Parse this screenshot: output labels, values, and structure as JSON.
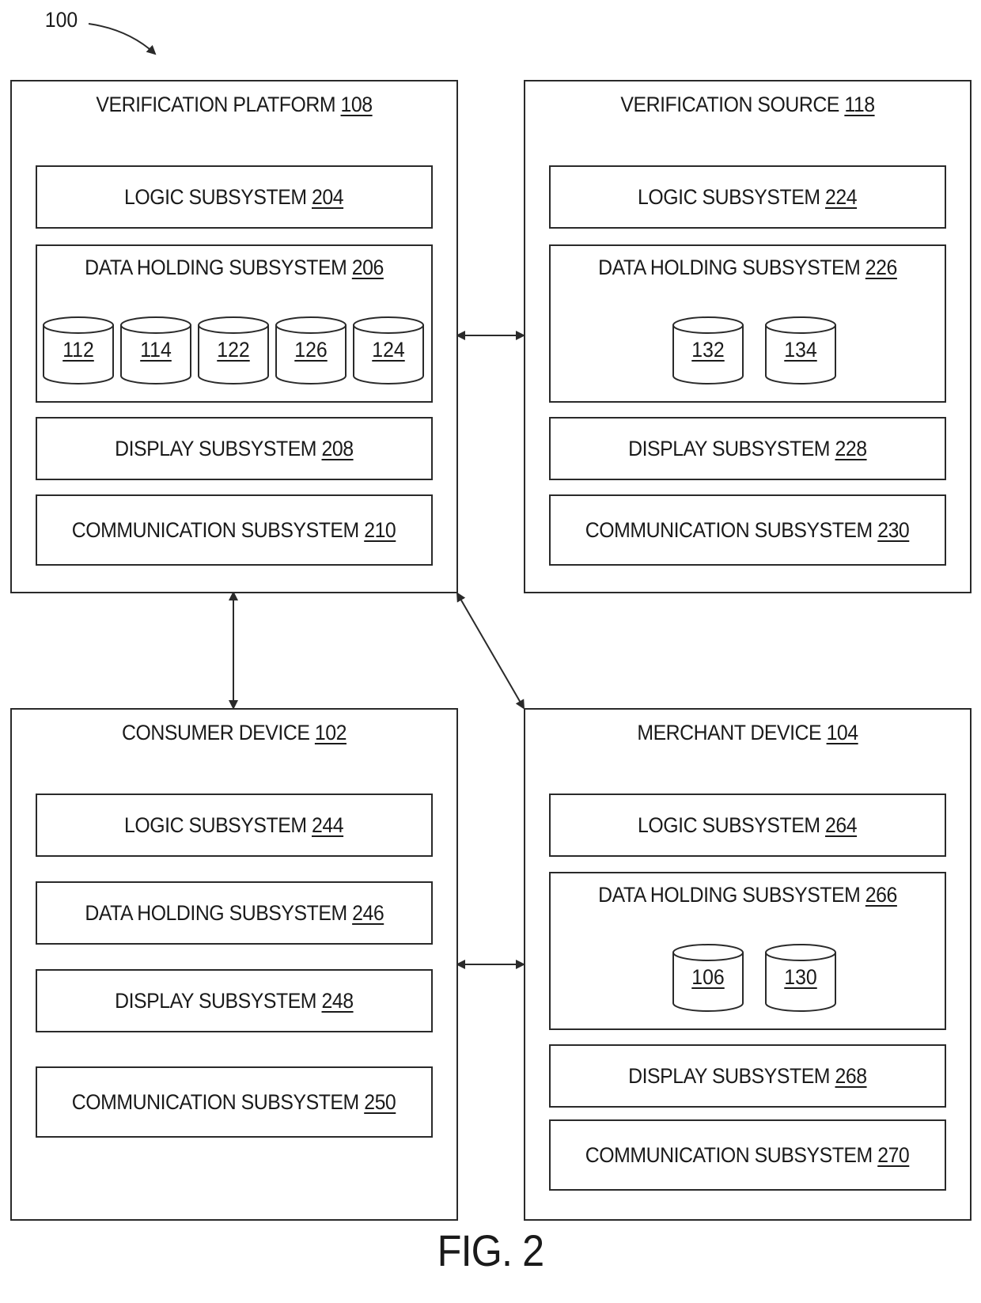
{
  "figure": {
    "ref_number": "100",
    "caption": "FIG. 2"
  },
  "blocks": {
    "verification_platform": {
      "title": "VERIFICATION PLATFORM ",
      "ref": "108",
      "logic": {
        "label": "LOGIC SUBSYSTEM ",
        "ref": "204"
      },
      "data_holding": {
        "label": "DATA HOLDING SUBSYSTEM ",
        "ref": "206",
        "databases": [
          "112",
          "114",
          "122",
          "126",
          "124"
        ]
      },
      "display": {
        "label": "DISPLAY SUBSYSTEM ",
        "ref": "208"
      },
      "communication": {
        "label": "COMMUNICATION SUBSYSTEM ",
        "ref": "210"
      }
    },
    "verification_source": {
      "title": "VERIFICATION SOURCE ",
      "ref": "118",
      "logic": {
        "label": "LOGIC SUBSYSTEM ",
        "ref": "224"
      },
      "data_holding": {
        "label": "DATA HOLDING SUBSYSTEM ",
        "ref": "226",
        "databases": [
          "132",
          "134"
        ]
      },
      "display": {
        "label": "DISPLAY SUBSYSTEM ",
        "ref": "228"
      },
      "communication": {
        "label": "COMMUNICATION SUBSYSTEM ",
        "ref": "230"
      }
    },
    "consumer_device": {
      "title": "CONSUMER DEVICE ",
      "ref": "102",
      "logic": {
        "label": "LOGIC SUBSYSTEM ",
        "ref": "244"
      },
      "data_holding": {
        "label": "DATA HOLDING SUBSYSTEM ",
        "ref": "246"
      },
      "display": {
        "label": "DISPLAY SUBSYSTEM ",
        "ref": "248"
      },
      "communication": {
        "label": "COMMUNICATION SUBSYSTEM ",
        "ref": "250"
      }
    },
    "merchant_device": {
      "title": "MERCHANT DEVICE ",
      "ref": "104",
      "logic": {
        "label": "LOGIC SUBSYSTEM ",
        "ref": "264"
      },
      "data_holding": {
        "label": "DATA HOLDING SUBSYSTEM ",
        "ref": "266",
        "databases": [
          "106",
          "130"
        ]
      },
      "display": {
        "label": "DISPLAY SUBSYSTEM ",
        "ref": "268"
      },
      "communication": {
        "label": "COMMUNICATION SUBSYSTEM ",
        "ref": "270"
      }
    }
  },
  "connections": [
    {
      "from": "verification_platform",
      "to": "verification_source",
      "type": "bidirectional"
    },
    {
      "from": "verification_platform",
      "to": "consumer_device",
      "type": "bidirectional"
    },
    {
      "from": "verification_platform",
      "to": "merchant_device",
      "type": "bidirectional"
    },
    {
      "from": "consumer_device",
      "to": "merchant_device",
      "type": "bidirectional"
    }
  ]
}
